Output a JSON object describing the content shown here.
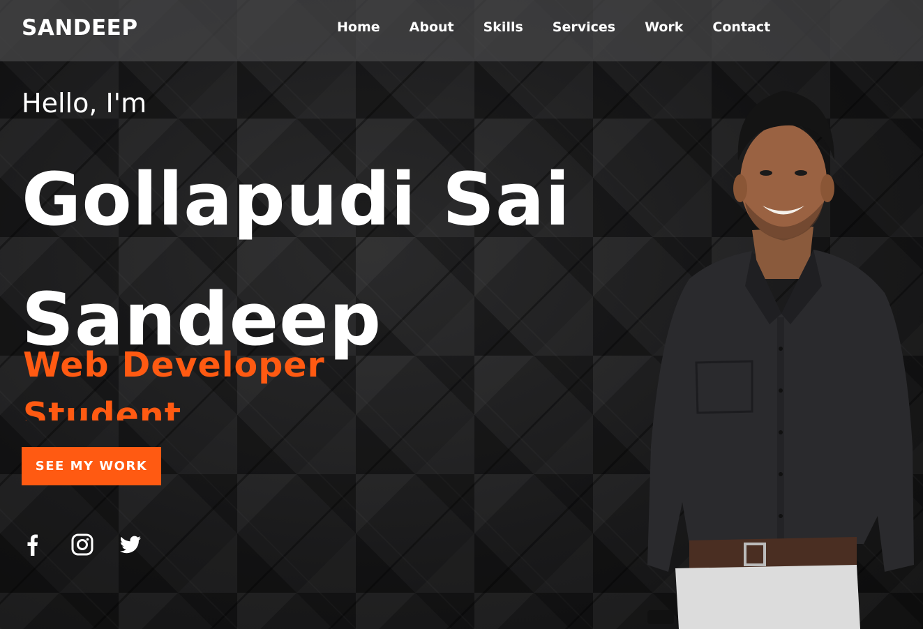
{
  "brand": {
    "logo_text": "SANDEEP"
  },
  "nav": {
    "items": [
      "Home",
      "About",
      "Skills",
      "Services",
      "Work",
      "Contact"
    ]
  },
  "hero": {
    "greeting": "Hello, I'm",
    "name_line1": "Gollapudi Sai",
    "name_line2": "Sandeep",
    "roles": [
      "Web Developer",
      "Student"
    ],
    "cta_label": "SEE MY WORK"
  },
  "social": {
    "icons": [
      "facebook-icon",
      "instagram-icon",
      "twitter-icon"
    ]
  },
  "colors": {
    "accent": "#ff5a12",
    "header_bg": "#464648",
    "text": "#ffffff",
    "background": "#1b1b1c"
  }
}
